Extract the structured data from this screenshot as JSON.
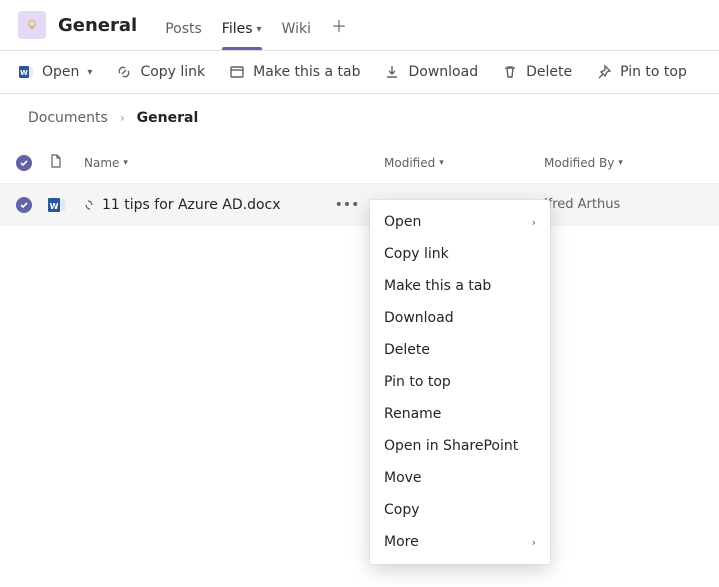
{
  "header": {
    "channel_name": "General",
    "tabs": {
      "posts": "Posts",
      "files": "Files",
      "wiki": "Wiki"
    }
  },
  "commands": {
    "open": "Open",
    "copy_link": "Copy link",
    "make_tab": "Make this a tab",
    "download": "Download",
    "delete": "Delete",
    "pin": "Pin to top"
  },
  "breadcrumb": {
    "root": "Documents",
    "current": "General"
  },
  "columns": {
    "name": "Name",
    "modified": "Modified",
    "modified_by": "Modified By"
  },
  "row": {
    "file_name": "11 tips for Azure AD.docx",
    "modified_by": "lfred Arthus"
  },
  "menu": {
    "open": "Open",
    "copy_link": "Copy link",
    "make_tab": "Make this a tab",
    "download": "Download",
    "delete": "Delete",
    "pin": "Pin to top",
    "rename": "Rename",
    "open_sp": "Open in SharePoint",
    "move": "Move",
    "copy": "Copy",
    "more": "More"
  }
}
